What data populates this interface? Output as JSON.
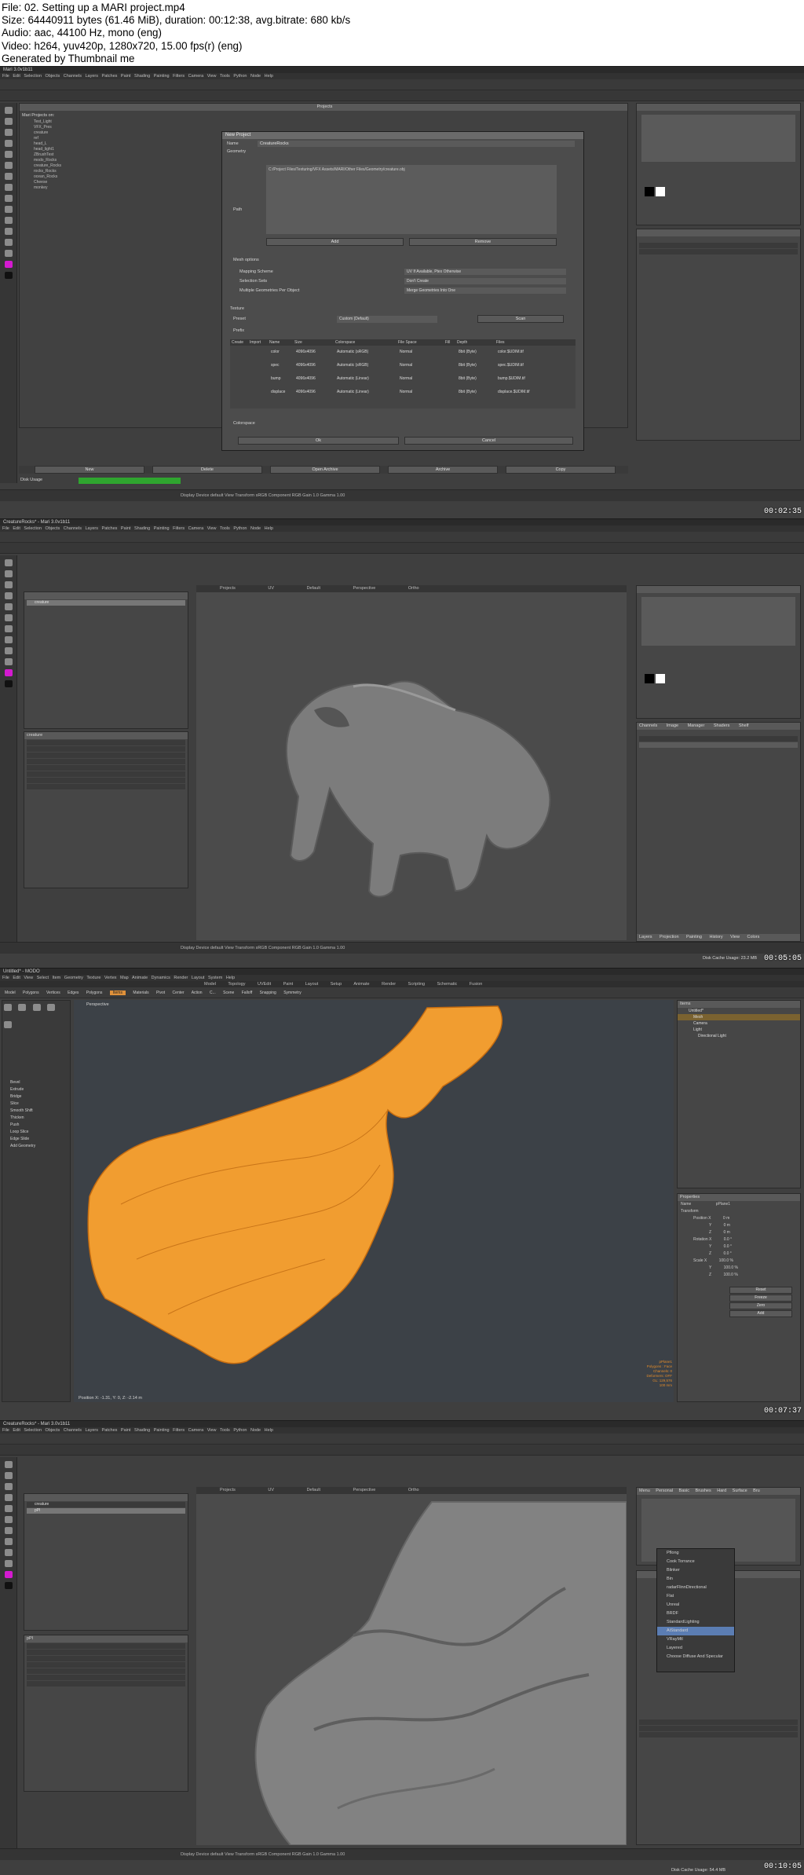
{
  "header": {
    "lines": [
      "File: 02. Setting up a MARI project.mp4",
      "Size: 64440911 bytes (61.46 MiB), duration: 00:12:38, avg.bitrate: 680 kb/s",
      "Audio: aac, 44100 Hz, mono (eng)",
      "Video: h264, yuv420p, 1280x720, 15.00 fps(r) (eng)",
      "Generated by Thumbnail me"
    ]
  },
  "frames": [
    {
      "timestamp": "00:02:35",
      "window_title": "Mari 3.0v1b11",
      "menu": "File  Edit  Selection  Objects  Channels  Layers  Patches  Paint  Shading  Painting  Filters  Camera  View  Tools  Python  Node  Help",
      "projects_header": "Projects",
      "projects_label": "Mari Projects on:",
      "projects": [
        "Test_Light",
        "VFX_Pres",
        "creature",
        "ref",
        "head_L",
        "head_light1",
        "ZBrushTest",
        "modo_Rocks",
        "creature_Rocks",
        "rocks_Rocks",
        "ocean_Rocks",
        "Cheese",
        "monkey"
      ],
      "bottom_buttons": [
        "New",
        "Delete",
        "Open Archive",
        "Archive",
        "Copy"
      ],
      "disk_usage_label": "Disk Usage",
      "status_bar": "Display Device  default   View Transform  sRGB   Component  RGB   Gain  1.0   Gamma  1.00",
      "dialog": {
        "title": "New Project",
        "name_label": "Name",
        "name_value": "CreatureRocks",
        "geometry_label": "Geometry",
        "path_label": "Path",
        "path_value": "C:/Project Files/Texturing/VFX Assets/MARI/Other Files/Geometry/creature.obj",
        "add_button": "Add",
        "remove_button": "Remove",
        "mesh_options_label": "Mesh options",
        "mapping_scheme_label": "Mapping Scheme",
        "mapping_scheme_value": "UV If Available, Ptex Otherwise",
        "selection_sets_label": "Selection Sets",
        "selection_sets_value": "Don't Create",
        "multiple_geometries_label": "Multiple Geometries Per Object",
        "multiple_geometries_value": "Merge Geometries Into One",
        "texture_label": "Texture",
        "preset_label": "Preset",
        "preset_value": "Custom (Default)",
        "prefix_label": "Prefix",
        "scan_button": "Scan",
        "table_headers": [
          "Create",
          "Import",
          "Name",
          "Size",
          "Colorspace",
          "File Space",
          "Fill",
          "Depth",
          "Files"
        ],
        "table_rows": [
          {
            "name": "color",
            "size": "4096x4096",
            "colorspace": "Automatic (sRGB)",
            "filespace": "Normal",
            "depth": "8bit (Byte)",
            "files": "color.$UDIM.tif"
          },
          {
            "name": "spec",
            "size": "4096x4096",
            "colorspace": "Automatic (sRGB)",
            "filespace": "Normal",
            "depth": "8bit (Byte)",
            "files": "spec.$UDIM.tif"
          },
          {
            "name": "bump",
            "size": "4096x4096",
            "colorspace": "Automatic (Linear)",
            "filespace": "Normal",
            "depth": "8bit (Byte)",
            "files": "bump.$UDIM.tif"
          },
          {
            "name": "displace",
            "size": "4096x4096",
            "colorspace": "Automatic (Linear)",
            "filespace": "Normal",
            "depth": "8bit (Byte)",
            "files": "displace.$UDIM.tif"
          }
        ],
        "colorspace_label": "Colorspace",
        "ok_button": "Ok",
        "cancel_button": "Cancel"
      }
    },
    {
      "timestamp": "00:05:05",
      "window_title": "CreatureRocks* - Mari 3.0v1b11",
      "menu": "File  Edit  Selection  Objects  Channels  Layers  Patches  Paint  Shading  Painting  Filters  Camera  View  Tools  Python  Node  Help",
      "viewport_tabs": [
        "Projects",
        "UV",
        "Default",
        "Perspective",
        "Ortho"
      ],
      "object_name": "creature",
      "panel_tabs": [
        "Channels",
        "Image Manager",
        "Shaders",
        "Shelf"
      ],
      "layers_tabs": [
        "Layers",
        "Projection",
        "Painting",
        "History View",
        "Colors"
      ],
      "status_bar": "Display Device  default   View Transform  sRGB   Component  RGB   Gain  1.0   Gamma  1.00",
      "cache": "Disk Cache Usage: 23.2 MB"
    },
    {
      "timestamp": "00:07:37",
      "window_title": "Untitled* - MODO",
      "menu": "File  Edit  View  Select  Item  Geometry  Texture  Vertex Map  Animate  Dynamics  Render  Layout  System  Help",
      "layouts": [
        "Model",
        "Topology",
        "UVEdit",
        "Paint",
        "Layout",
        "Setup",
        "Animate",
        "Render",
        "Scripting",
        "Schematic Fusion"
      ],
      "modes": [
        "Model",
        "Polygons",
        "Vertices",
        "Edges",
        "Polygons",
        "Items",
        "Materials",
        "Pivot",
        "Center",
        "Action C...",
        "Scene",
        "Falloff",
        "Snapping",
        "Symmetry"
      ],
      "tool_items": [
        "Bevel",
        "Extrude",
        "Bridge",
        "Slice",
        "Smooth Shift",
        "Thicken",
        "Push",
        "Loop Slice",
        "Edge Slide",
        "Add Geometry"
      ],
      "items_title": "Items",
      "items": [
        "Untitled*",
        "Mesh",
        "Camera",
        "Light",
        "Directional Light"
      ],
      "properties_title": "Properties",
      "property_labels": [
        "Name",
        "Transform",
        "Position X",
        "Y",
        "Z",
        "Rotation X",
        "Y",
        "Z",
        "Scale X",
        "Y",
        "Z",
        "Reset",
        "Freeze",
        "Zero",
        "Add"
      ],
      "property_values": [
        "pPlane1",
        "0 m",
        "0 m",
        "0 m",
        "0.0 °",
        "0.0 °",
        "0.0 °",
        "100.0 %",
        "100.0 %",
        "100.0 %"
      ],
      "mesh_info": "pPlane1\nPolygons : Face\nChannels: 0\nDeformers: OFF\nGL: 129,576\n100 mm",
      "position_readout": "Position X: -1.31, Y: 0, Z: -2.14 m",
      "viewport_label": "Perspective"
    },
    {
      "timestamp": "00:10:05",
      "window_title": "CreatureRocks* - Mari 3.0v1b11",
      "menu": "File  Edit  Selection  Objects  Channels  Layers  Patches  Paint  Shading  Painting  Filters  Camera  View  Tools  Python  Node  Help",
      "viewport_tabs": [
        "Projects",
        "UV",
        "Default",
        "Perspective",
        "Ortho"
      ],
      "objects": [
        "creature",
        "pPl"
      ],
      "shader_menu": [
        "Pflong",
        "Cook Torrance",
        "Blinker",
        "Bin",
        "radarFlinnDirectional",
        "Flat",
        "Unreal",
        "BRDF",
        "StandardLighting",
        "AiStandard",
        "VRayMtl",
        "Layered",
        "Choose Diffuse And Specular"
      ],
      "shader_selected": "AiStandard",
      "brush_tabs": [
        "Menu",
        "Personal",
        "Basic Brushes",
        "Hard Surface Bru"
      ],
      "status_bar": "Display Device  default   View Transform  sRGB   Component  RGB   Gain  1.0   Gamma  1.00",
      "cache": "Disk Cache Usage: 54.4 MB"
    }
  ]
}
